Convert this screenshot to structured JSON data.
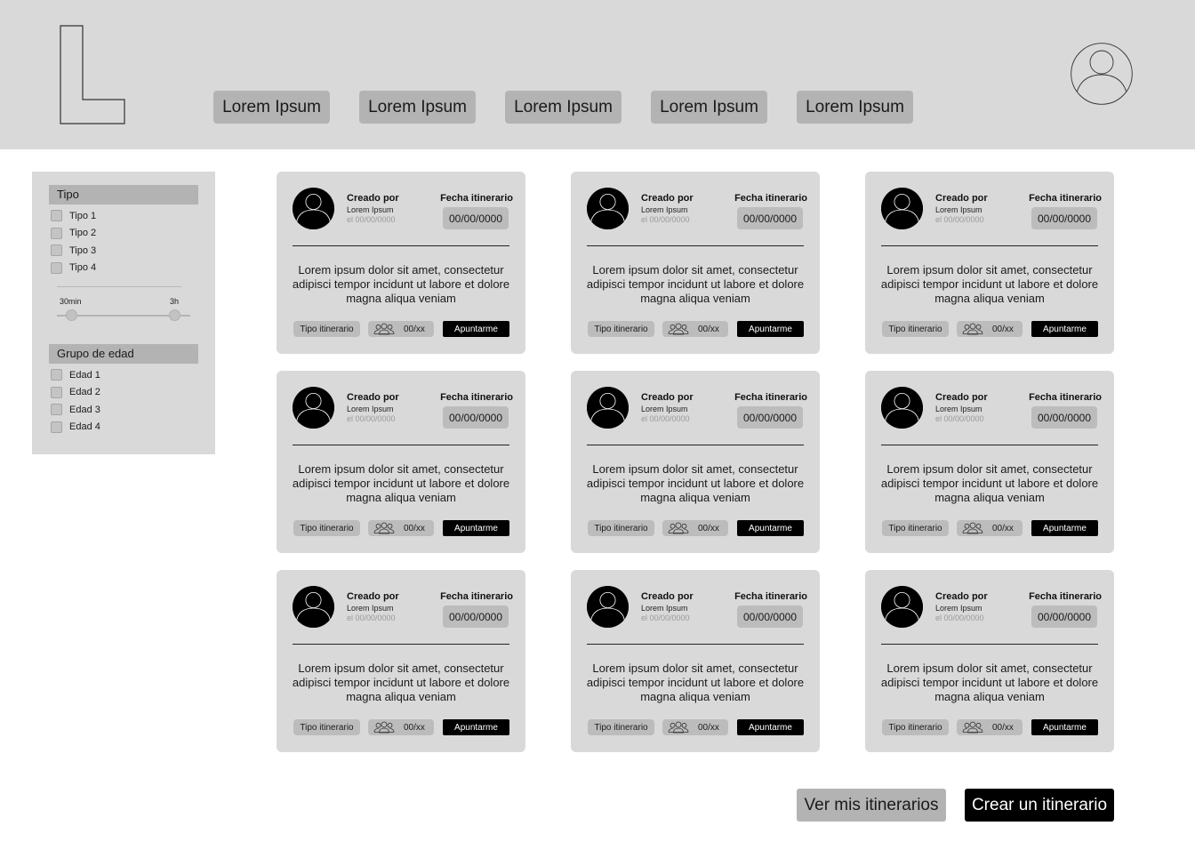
{
  "header": {
    "logo_letter": "L",
    "nav": [
      "Lorem Ipsum",
      "Lorem Ipsum",
      "Lorem Ipsum",
      "Lorem Ipsum",
      "Lorem Ipsum"
    ],
    "avatar_icon": "user-avatar-icon"
  },
  "filters": {
    "tipo": {
      "title": "Tipo",
      "options": [
        "Tipo 1",
        "Tipo 2",
        "Tipo 3",
        "Tipo 4"
      ]
    },
    "duration": {
      "min_label": "30min",
      "max_label": "3h"
    },
    "edad": {
      "title": "Grupo de edad",
      "options": [
        "Edad 1",
        "Edad 2",
        "Edad 3",
        "Edad 4"
      ]
    }
  },
  "card_template": {
    "created_title": "Creado por",
    "created_name": "Lorem Ipsum",
    "created_date": "el 00/00/0000",
    "date_title": "Fecha itinerario",
    "date_value": "00/00/0000",
    "description": "Lorem ipsum dolor sit amet, consectetur adipisci tempor incidunt ut labore et dolore magna aliqua veniam",
    "tipo_label": "Tipo itinerario",
    "count_label": "00/xx",
    "join_label": "Apuntarme"
  },
  "cards": [
    {
      "created_title": "Creado por",
      "created_name": "Lorem Ipsum",
      "created_date": "el 00/00/0000",
      "date_title": "Fecha itinerario",
      "date_value": "00/00/0000",
      "description": "Lorem ipsum dolor sit amet, consectetur adipisci tempor incidunt ut labore et dolore magna aliqua veniam",
      "tipo_label": "Tipo itinerario",
      "count_label": "00/xx",
      "join_label": "Apuntarme"
    },
    {
      "created_title": "Creado por",
      "created_name": "Lorem Ipsum",
      "created_date": "el 00/00/0000",
      "date_title": "Fecha itinerario",
      "date_value": "00/00/0000",
      "description": "Lorem ipsum dolor sit amet, consectetur adipisci tempor incidunt ut labore et dolore magna aliqua veniam",
      "tipo_label": "Tipo itinerario",
      "count_label": "00/xx",
      "join_label": "Apuntarme"
    },
    {
      "created_title": "Creado por",
      "created_name": "Lorem Ipsum",
      "created_date": "el 00/00/0000",
      "date_title": "Fecha itinerario",
      "date_value": "00/00/0000",
      "description": "Lorem ipsum dolor sit amet, consectetur adipisci tempor incidunt ut labore et dolore magna aliqua veniam",
      "tipo_label": "Tipo itinerario",
      "count_label": "00/xx",
      "join_label": "Apuntarme"
    },
    {
      "created_title": "Creado por",
      "created_name": "Lorem Ipsum",
      "created_date": "el 00/00/0000",
      "date_title": "Fecha itinerario",
      "date_value": "00/00/0000",
      "description": "Lorem ipsum dolor sit amet, consectetur adipisci tempor incidunt ut labore et dolore magna aliqua veniam",
      "tipo_label": "Tipo itinerario",
      "count_label": "00/xx",
      "join_label": "Apuntarme"
    },
    {
      "created_title": "Creado por",
      "created_name": "Lorem Ipsum",
      "created_date": "el 00/00/0000",
      "date_title": "Fecha itinerario",
      "date_value": "00/00/0000",
      "description": "Lorem ipsum dolor sit amet, consectetur adipisci tempor incidunt ut labore et dolore magna aliqua veniam",
      "tipo_label": "Tipo itinerario",
      "count_label": "00/xx",
      "join_label": "Apuntarme"
    },
    {
      "created_title": "Creado por",
      "created_name": "Lorem Ipsum",
      "created_date": "el 00/00/0000",
      "date_title": "Fecha itinerario",
      "date_value": "00/00/0000",
      "description": "Lorem ipsum dolor sit amet, consectetur adipisci tempor incidunt ut labore et dolore magna aliqua veniam",
      "tipo_label": "Tipo itinerario",
      "count_label": "00/xx",
      "join_label": "Apuntarme"
    },
    {
      "created_title": "Creado por",
      "created_name": "Lorem Ipsum",
      "created_date": "el 00/00/0000",
      "date_title": "Fecha itinerario",
      "date_value": "00/00/0000",
      "description": "Lorem ipsum dolor sit amet, consectetur adipisci tempor incidunt ut labore et dolore magna aliqua veniam",
      "tipo_label": "Tipo itinerario",
      "count_label": "00/xx",
      "join_label": "Apuntarme"
    },
    {
      "created_title": "Creado por",
      "created_name": "Lorem Ipsum",
      "created_date": "el 00/00/0000",
      "date_title": "Fecha itinerario",
      "date_value": "00/00/0000",
      "description": "Lorem ipsum dolor sit amet, consectetur adipisci tempor incidunt ut labore et dolore magna aliqua veniam",
      "tipo_label": "Tipo itinerario",
      "count_label": "00/xx",
      "join_label": "Apuntarme"
    },
    {
      "created_title": "Creado por",
      "created_name": "Lorem Ipsum",
      "created_date": "el 00/00/0000",
      "date_title": "Fecha itinerario",
      "date_value": "00/00/0000",
      "description": "Lorem ipsum dolor sit amet, consectetur adipisci tempor incidunt ut labore et dolore magna aliqua veniam",
      "tipo_label": "Tipo itinerario",
      "count_label": "00/xx",
      "join_label": "Apuntarme"
    }
  ],
  "actions": {
    "my_itineraries": "Ver mis itinerarios",
    "create_itinerary": "Crear un itinerario"
  }
}
